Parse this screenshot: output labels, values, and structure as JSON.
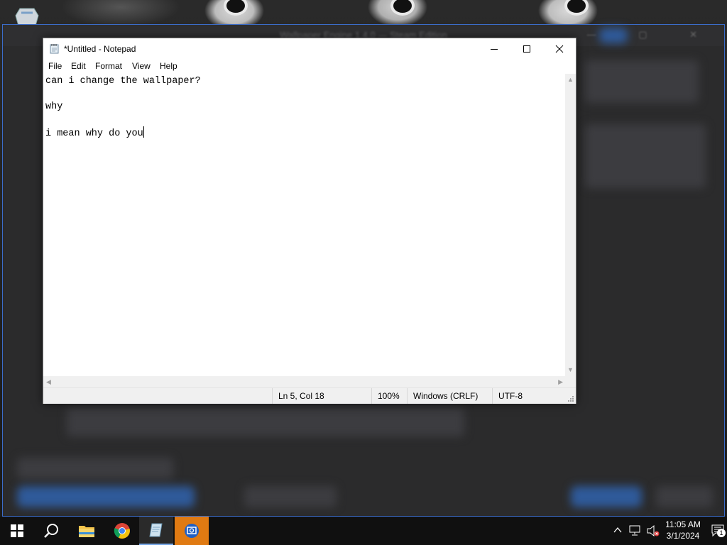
{
  "notepad": {
    "title": "*Untitled - Notepad",
    "menu": [
      "File",
      "Edit",
      "Format",
      "View",
      "Help"
    ],
    "content_lines": [
      "can i change the wallpaper?",
      "",
      "why",
      "",
      "i mean why do you"
    ],
    "status": {
      "position": "Ln 5, Col 18",
      "zoom": "100%",
      "line_ending": "Windows (CRLF)",
      "encoding": "UTF-8"
    }
  },
  "background_window": {
    "title": "Wallpaper Engine 1.4.0 — Steam Edition"
  },
  "taskbar": {
    "icons": [
      "windows-start-icon",
      "search-icon",
      "file-explorer-icon",
      "chrome-icon",
      "notepad-icon",
      "wallpaper-engine-icon"
    ],
    "clock": {
      "time": "11:05 AM",
      "date": "3/1/2024"
    },
    "notification_count": "1"
  },
  "colors": {
    "taskbar": "#101010",
    "accent_blue": "#3b6cc9",
    "active_app": "#e07a12"
  }
}
